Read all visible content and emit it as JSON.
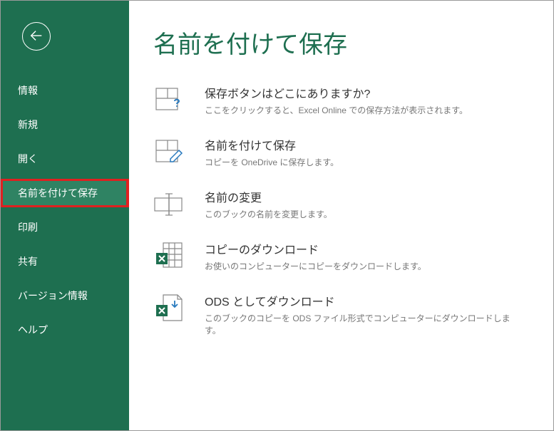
{
  "page_title": "名前を付けて保存",
  "sidebar": {
    "items": [
      {
        "label": "情報"
      },
      {
        "label": "新規"
      },
      {
        "label": "開く"
      },
      {
        "label": "名前を付けて保存",
        "active": true
      },
      {
        "label": "印刷"
      },
      {
        "label": "共有"
      },
      {
        "label": "バージョン情報"
      },
      {
        "label": "ヘルプ"
      }
    ]
  },
  "options": [
    {
      "title": "保存ボタンはどこにありますか?",
      "desc": "ここをクリックすると、Excel Online での保存方法が表示されます。"
    },
    {
      "title": "名前を付けて保存",
      "desc": "コピーを OneDrive に保存します。"
    },
    {
      "title": "名前の変更",
      "desc": "このブックの名前を変更します。"
    },
    {
      "title": "コピーのダウンロード",
      "desc": "お使いのコンピューターにコピーをダウンロードします。"
    },
    {
      "title": "ODS としてダウンロード",
      "desc": "このブックのコピーを ODS ファイル形式でコンピューターにダウンロードします。"
    }
  ]
}
